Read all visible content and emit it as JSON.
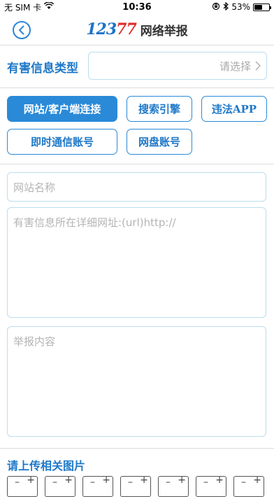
{
  "status_bar": {
    "carrier": "无 SIM 卡",
    "time": "10:36",
    "battery_percent": "53%",
    "battery_level": 0.53
  },
  "header": {
    "logo_number": "12377",
    "title": "网络举报"
  },
  "type_row": {
    "label": "有害信息类型",
    "placeholder": "请选择"
  },
  "categories": [
    {
      "label": "网站/客户端连接",
      "active": true
    },
    {
      "label": "搜索引擎",
      "active": false
    },
    {
      "label": "违法APP",
      "active": false
    },
    {
      "label": "即时通信账号",
      "active": false
    },
    {
      "label": "网盘账号",
      "active": false
    }
  ],
  "fields": {
    "site_name_placeholder": "网站名称",
    "url_placeholder": "有害信息所在详细网址:(url)http://",
    "content_placeholder": "举报内容"
  },
  "upload": {
    "title": "请上传相关图片",
    "slot_plus": "+",
    "slot_minus": "–"
  },
  "colors": {
    "accent": "#2a8ad8",
    "label_blue": "#1e78c8",
    "logo_red": "#e02b2b"
  }
}
